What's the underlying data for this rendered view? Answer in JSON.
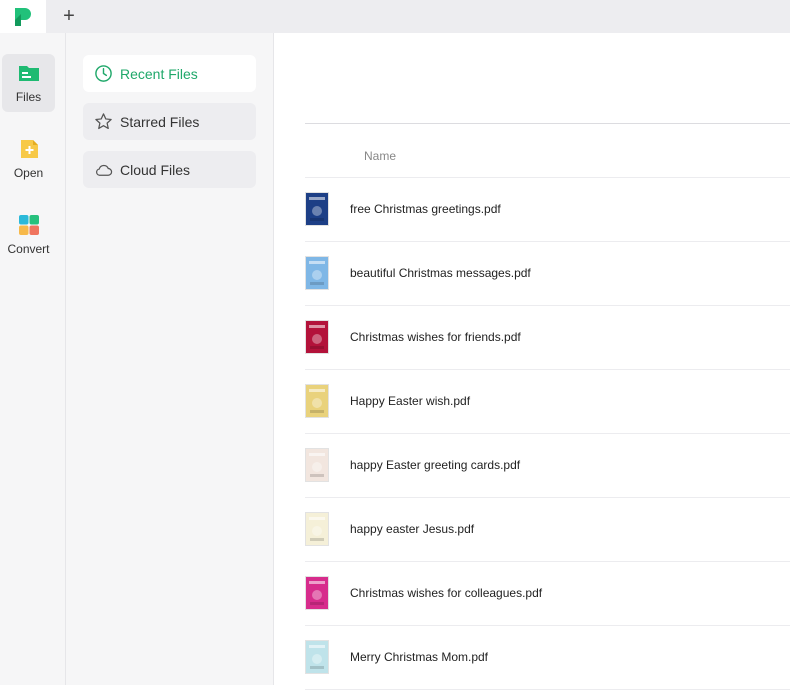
{
  "tabs": {
    "new_tab_symbol": "+"
  },
  "rail": {
    "items": [
      {
        "label": "Files",
        "icon": "files-icon",
        "active": true
      },
      {
        "label": "Open",
        "icon": "open-file-icon",
        "active": false
      },
      {
        "label": "Convert",
        "icon": "convert-icon",
        "active": false
      }
    ]
  },
  "nav": {
    "items": [
      {
        "label": "Recent Files",
        "icon": "clock-icon",
        "active": true
      },
      {
        "label": "Starred Files",
        "icon": "star-icon",
        "active": false
      },
      {
        "label": "Cloud Files",
        "icon": "cloud-icon",
        "active": false
      }
    ]
  },
  "file_list": {
    "column_name": "Name",
    "files": [
      {
        "name": "free Christmas greetings.pdf",
        "thumb_color": "#1d3f86"
      },
      {
        "name": "beautiful Christmas messages.pdf",
        "thumb_color": "#7fb7e6"
      },
      {
        "name": "Christmas wishes for friends.pdf",
        "thumb_color": "#b3123a"
      },
      {
        "name": "Happy Easter wish.pdf",
        "thumb_color": "#e9d27c"
      },
      {
        "name": "happy Easter greeting cards.pdf",
        "thumb_color": "#f2e6df"
      },
      {
        "name": "happy easter Jesus.pdf",
        "thumb_color": "#f5f0d8"
      },
      {
        "name": "Christmas wishes for colleagues.pdf",
        "thumb_color": "#d72c8c"
      },
      {
        "name": "Merry Christmas Mom.pdf",
        "thumb_color": "#bfe3ea"
      }
    ]
  },
  "colors": {
    "accent": "#1fa86a",
    "sidebar_bg": "#f6f6f7",
    "topbar_bg": "#ededf0"
  }
}
